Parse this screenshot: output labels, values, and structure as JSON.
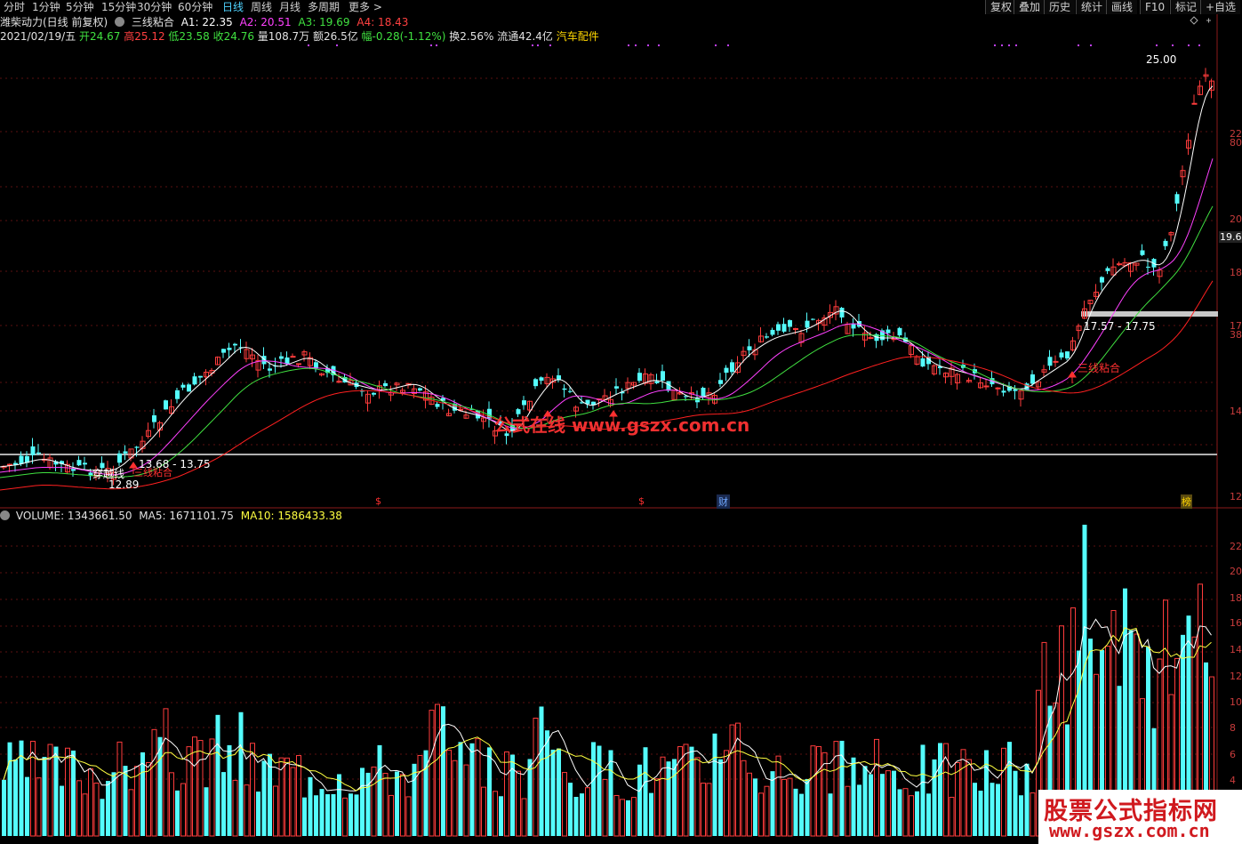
{
  "toolbar": {
    "periods": [
      "分时",
      "1分钟",
      "5分钟",
      "15分钟",
      "30分钟",
      "60分钟",
      "日线",
      "周线",
      "月线",
      "多周期",
      "更多 >"
    ],
    "active_period": "日线",
    "right_buttons": [
      "复权",
      "叠加",
      "历史",
      "统计",
      "画线",
      "F10",
      "标记",
      "+自选"
    ]
  },
  "header": {
    "stock_name": "潍柴动力(日线 前复权)",
    "indicator_name": "三线粘合",
    "a1_label": "A1: 22.35",
    "a2_label": "A2: 20.51",
    "a3_label": "A3: 19.69",
    "a4_label": "A4: 18.43"
  },
  "quote": {
    "date": "2021/02/19/五",
    "open": "开24.67",
    "high": "高25.12",
    "low": "低23.58",
    "close": "收24.76",
    "volume": "量108.7万",
    "amount": "额26.5亿",
    "change": "幅-0.28(-1.12%)",
    "turnover": "换2.56%",
    "float": "流通42.4亿",
    "sector": "汽车配件"
  },
  "volume_header": {
    "volume": "VOLUME: 1343661.50",
    "ma5": "MA5: 1671101.75",
    "ma10": "MA10: 1586433.38"
  },
  "annotations": {
    "peak": "25.00",
    "right_range": "17.57 - 17.75",
    "left_range": "13.68 - 13.75",
    "low_label": "12.89",
    "signal_right": "三线粘合",
    "signal_left": "三线粘合",
    "cross_left": "穿越线",
    "fin_mark": "财",
    "rank_mark": "榜",
    "site_overlay": "公式在线 www.gszx.com.cn",
    "dollar_mark": "$",
    "current_price_tag": "19.6"
  },
  "price_axis": [
    "22",
    "80",
    "20",
    "18",
    "17",
    "38",
    "14",
    "12"
  ],
  "volume_axis": [
    "22",
    "20",
    "18",
    "16",
    "14",
    "12",
    "10",
    "8",
    "6",
    "4"
  ],
  "watermark": {
    "line1": "股票公式指标网",
    "line2": "www.gszx.com.cn"
  },
  "colors": {
    "up": "#ff3c3c",
    "down": "#54fcfc",
    "ma_white": "#ffffff",
    "ma_magenta": "#ff40ff",
    "ma_green": "#40e040",
    "ma_red": "#ff2020",
    "grid": "#8b1a1a"
  }
}
